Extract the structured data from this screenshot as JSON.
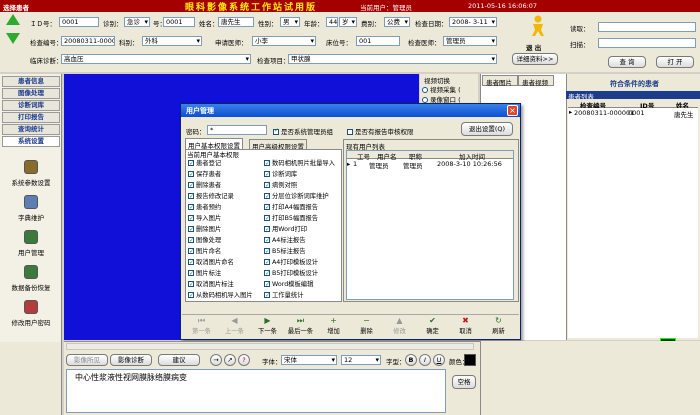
{
  "header": {
    "left_title": "选择患者",
    "app_title": "眼科影像系统工作站试用版",
    "current_user": "当前用户：管理员",
    "datetime": "2011-05-16 16:06:07",
    "colors": {
      "bar": "#a40000",
      "text": "#ffffff",
      "title": "#ffea00"
    }
  },
  "patient_form": {
    "id_label": "ＩＤ号：",
    "id_value": "0001",
    "diagnosis_label": "诊别：",
    "diagnosis_value": "急诊",
    "number_label": "号：",
    "number_value": "0001",
    "name_label": "姓名：",
    "name_value": "唐先生",
    "gender_label": "性别：",
    "gender_value": "男",
    "age_label": "年龄：",
    "age_value": "44",
    "age_unit": "岁",
    "fee_label": "费别：",
    "fee_value": "公费",
    "exam_date_label": "检查日期：",
    "exam_date_value": "2008- 3-11",
    "exam_no_label": "检查编号：",
    "exam_no_value": "20080311-000001",
    "dept_label": "科别：",
    "dept_value": "外科",
    "applicant_label": "申请医师：",
    "applicant_value": "小李",
    "bed_label": "床位号：",
    "bed_value": "001",
    "examiner_label": "检查医师：",
    "examiner_value": "管理员",
    "clinical_label": "临床诊断：",
    "clinical_value": "高血压",
    "exam_item_label": "检查项目：",
    "exam_item_value": "甲状腺"
  },
  "exit_label": "退 出",
  "detail_button": "详细资料>>",
  "search": {
    "reader_label": "读取：",
    "scan_label": "扫描：",
    "query_button": "查 询",
    "open_button": "打 开"
  },
  "nav": {
    "tabs": [
      "患者信息",
      "图像处理",
      "诊断词库",
      "打印报告",
      "查询统计",
      "系统设置"
    ],
    "items": [
      {
        "icon": "system-params-icon",
        "label": "系统参数设置"
      },
      {
        "icon": "dictionary-icon",
        "label": "字典维护"
      },
      {
        "icon": "user-management-icon",
        "label": "用户管理"
      },
      {
        "icon": "backup-restore-icon",
        "label": "数据备份恢复"
      },
      {
        "icon": "change-password-icon",
        "label": "修改用户密码"
      }
    ]
  },
  "video": {
    "label": "视频切换",
    "options": [
      "视频采集 (",
      "录像窗口 ("
    ]
  },
  "right_panel": {
    "tabs": [
      "患者图片",
      "患者视频"
    ],
    "patients_title": "符合条件的患者",
    "list_label": "患者列表",
    "columns": [
      "检查编号",
      "ID号",
      "姓名"
    ],
    "rows": [
      [
        "20080311-000001",
        "0001",
        "唐先生"
      ]
    ]
  },
  "dialog": {
    "title": "用户管理",
    "password_label": "密码：",
    "password_value": "*",
    "is_admin_label": "是否系统管理员组",
    "is_reviewer_label": "是否有报告审核权限",
    "exit_button": "退出设置(Q)",
    "tabs": [
      "用户基本权限设置",
      "用户高级权限设置"
    ],
    "perm_group_label": "当前用户基本权限",
    "perms_left": [
      "患者登记",
      "保存患者",
      "删除患者",
      "报告修改记录",
      "患者预约",
      "导入图片",
      "删除图片",
      "图像处理",
      "图片命名",
      "取消图片命名",
      "图片标注",
      "取消图片标注",
      "从数码相机导入图片"
    ],
    "perms_right": [
      "数码相机照片批量导入",
      "诊断词库",
      "病例对照",
      "分层位诊断词库维护",
      "打印A4幅面报告",
      "打印B5幅面报告",
      "用Word打印",
      "A4标注报告",
      "B5标注报告",
      "A4打印模板设计",
      "B5打印模板设计",
      "Word模板编辑",
      "工作量统计"
    ],
    "list_label": "现有用户列表",
    "columns": [
      "工号",
      "用户名",
      "职称",
      "加入时间"
    ],
    "rows": [
      [
        "1",
        "管理员",
        "管理员",
        "2008-3-10 10:26:56"
      ]
    ],
    "nav_buttons": [
      "第一条",
      "上一条",
      "下一条",
      "最后一条",
      "增加",
      "删除",
      "修改",
      "确定",
      "取消",
      "刷新"
    ]
  },
  "editor": {
    "buttons": [
      "影像所见",
      "影像诊断",
      "建议"
    ],
    "font_label": "字体：",
    "font_value": "宋体",
    "size_value": "12",
    "style_label": "字型：",
    "color_label": "颜色：",
    "text": "中心性浆液性视网膜脉络膜病变",
    "space_label": "空格"
  },
  "logo_text": "ЭЄ"
}
